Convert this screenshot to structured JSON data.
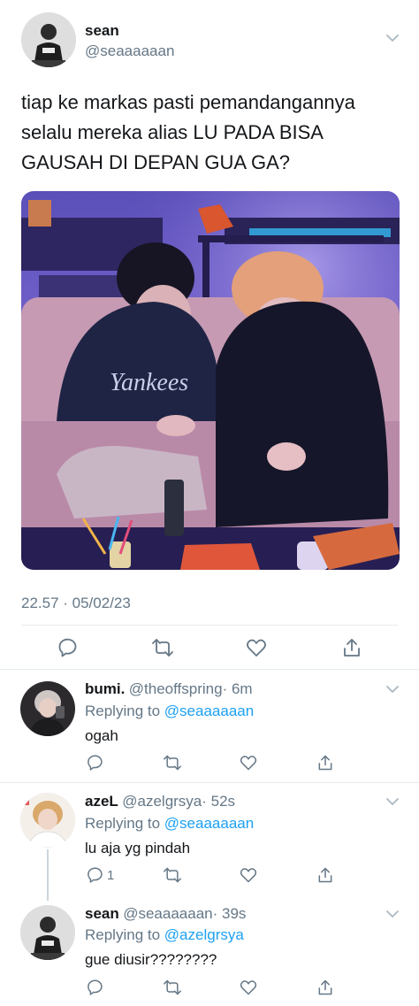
{
  "main_tweet": {
    "name": "sean",
    "handle": "@seaaaaaan",
    "text": "tiap ke markas pasti pemandangannya selalu mereka alias LU PADA BISA GAUSAH DI DEPAN GUA GA?",
    "timestamp": "22.57 · 05/02/23"
  },
  "replies": [
    {
      "name": "bumi.",
      "handle": "@theoffspring",
      "time": "· 6m",
      "replying_prefix": "Replying to",
      "replying_to": "@seaaaaaan",
      "text": "ogah",
      "reply_count": ""
    },
    {
      "name": "azeL",
      "handle": "@azelgrsya",
      "time": "· 52s",
      "replying_prefix": "Replying to",
      "replying_to": "@seaaaaaan",
      "text": "lu aja yg pindah",
      "reply_count": "1"
    },
    {
      "name": "sean",
      "handle": "@seaaaaaan",
      "time": "· 39s",
      "replying_prefix": "Replying to",
      "replying_to": "@azelgrsya",
      "text": "gue diusir????????",
      "reply_count": ""
    }
  ],
  "icons": [
    "reply-icon",
    "retweet-icon",
    "like-icon",
    "share-icon",
    "chevron-down-icon"
  ],
  "colors": {
    "link": "#1da1f2",
    "secondary": "#657786",
    "divider": "#e6ecf0"
  }
}
